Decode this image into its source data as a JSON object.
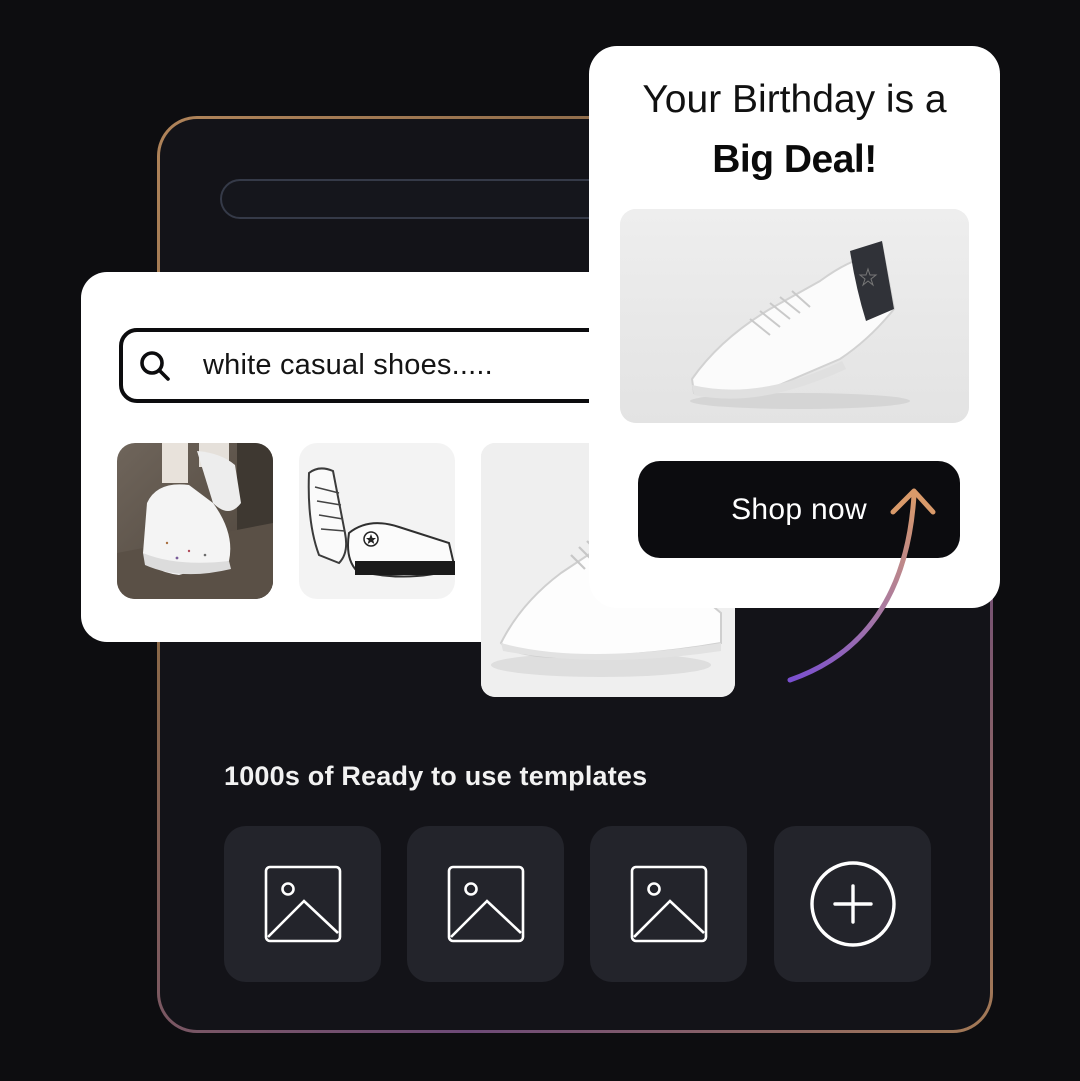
{
  "search": {
    "query": "white casual shoes....."
  },
  "promo": {
    "title_line1": "Your Birthday is a",
    "title_line2": "Big Deal!",
    "cta_label": "Shop now"
  },
  "templates": {
    "heading": "1000s of Ready to use templates",
    "tiles": [
      {
        "icon": "image-placeholder-icon"
      },
      {
        "icon": "image-placeholder-icon"
      },
      {
        "icon": "image-placeholder-icon"
      },
      {
        "icon": "add-circle-icon"
      }
    ]
  },
  "colors": {
    "background": "#0d0d10",
    "panel": "#131318",
    "tile": "#23242b",
    "accent_arrow_start": "#7a4fd0",
    "accent_arrow_end": "#d99a6a",
    "button": "#0c0c0f"
  }
}
